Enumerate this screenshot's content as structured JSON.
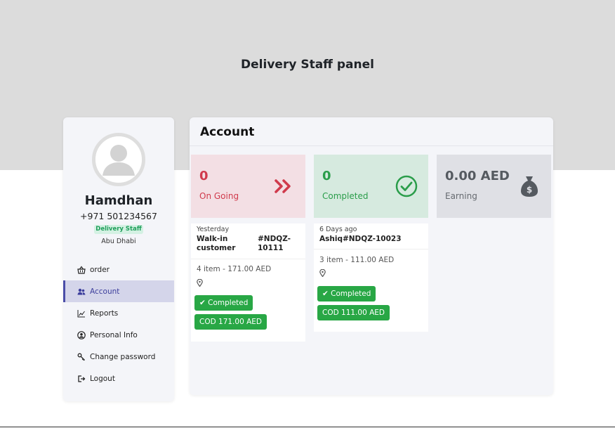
{
  "header": {
    "title": "Delivery Staff panel"
  },
  "profile": {
    "name": "Hamdhan",
    "phone": "+971 501234567",
    "role": "Delivery Staff",
    "location": "Abu Dhabi"
  },
  "menu": {
    "items": [
      {
        "label": "order",
        "icon": "basket-icon",
        "active": false
      },
      {
        "label": "Account",
        "icon": "users-icon",
        "active": true
      },
      {
        "label": "Reports",
        "icon": "chart-icon",
        "active": false
      },
      {
        "label": "Personal Info",
        "icon": "user-circle-icon",
        "active": false
      },
      {
        "label": "Change password",
        "icon": "key-icon",
        "active": false
      },
      {
        "label": "Logout",
        "icon": "logout-icon",
        "active": false
      }
    ]
  },
  "main": {
    "title": "Account",
    "stats": [
      {
        "value": "0",
        "label": "On Going",
        "icon": "double-chevron-right-icon"
      },
      {
        "value": "0",
        "label": "Completed",
        "icon": "check-circle-icon"
      },
      {
        "value": "0.00 AED",
        "label": "Earning",
        "icon": "money-bag-icon"
      }
    ],
    "orders": [
      {
        "time": "Yesterday",
        "customer_line1": "Walk-in",
        "customer_line2": "customer",
        "id_line1": "#NDQZ-",
        "id_line2": "10111",
        "summary": "4 item - 171.00 AED",
        "status": "✔ Completed",
        "payment": "COD 171.00 AED"
      },
      {
        "time": "6 Days ago",
        "title": "Ashiq#NDQZ-10023",
        "summary": "3 item - 111.00 AED",
        "status": "✔ Completed",
        "payment": "COD 111.00 AED"
      }
    ]
  },
  "colors": {
    "ongoing": "#d03a4c",
    "completed": "#2a9d4a",
    "button": "#28a745",
    "active_menu": "#4b4da8"
  }
}
